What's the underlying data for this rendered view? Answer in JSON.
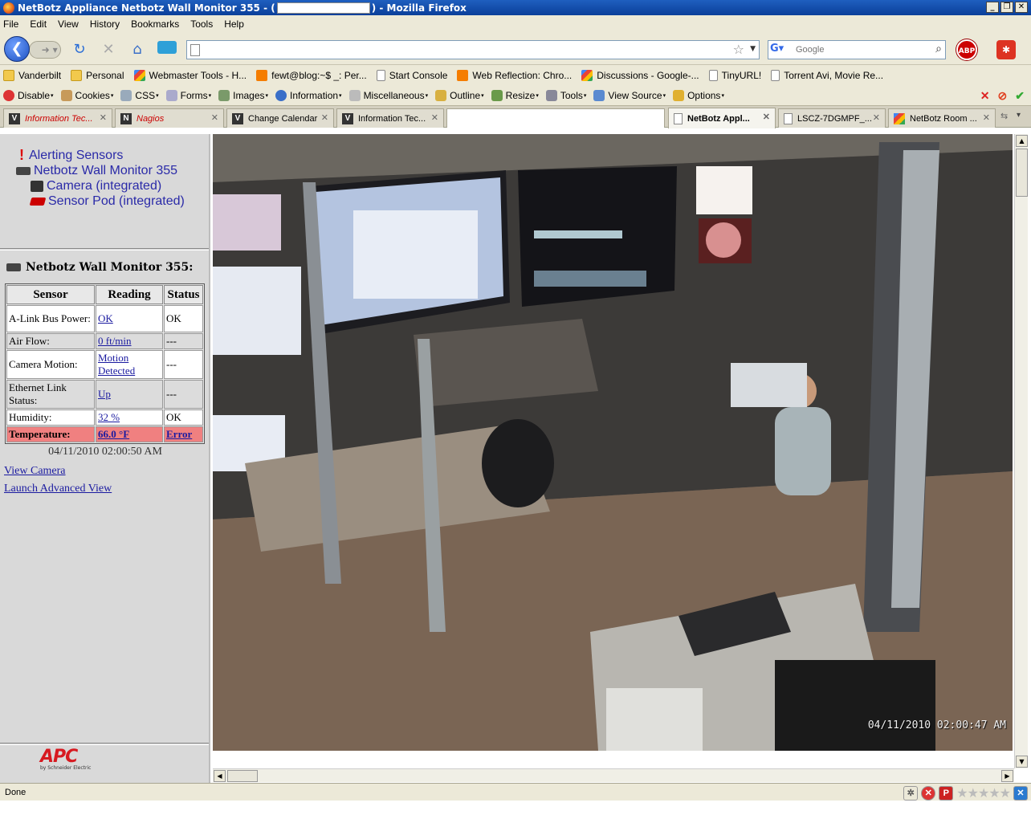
{
  "window": {
    "title_prefix": "NetBotz Appliance Netbotz Wall Monitor 355 - (",
    "title_suffix": ") - Mozilla Firefox",
    "minimize": "_",
    "restore": "❐",
    "close": "✕"
  },
  "menu": [
    "File",
    "Edit",
    "View",
    "History",
    "Bookmarks",
    "Tools",
    "Help"
  ],
  "search": {
    "placeholder": "Google"
  },
  "bookmarks": [
    {
      "label": "Vanderbilt",
      "icon": "folder"
    },
    {
      "label": "Personal",
      "icon": "folder"
    },
    {
      "label": "Webmaster Tools - H...",
      "icon": "google"
    },
    {
      "label": "fewt@blog:~$ _: Per...",
      "icon": "blogger"
    },
    {
      "label": "Start Console",
      "icon": "page"
    },
    {
      "label": "Web Reflection: Chro...",
      "icon": "blogger"
    },
    {
      "label": "Discussions - Google-...",
      "icon": "google"
    },
    {
      "label": "TinyURL!",
      "icon": "page"
    },
    {
      "label": "Torrent Avi, Movie Re...",
      "icon": "page"
    }
  ],
  "devtools": [
    {
      "label": "Disable",
      "icon": "disable-icon"
    },
    {
      "label": "Cookies",
      "icon": "cookies-icon"
    },
    {
      "label": "CSS",
      "icon": "css-icon"
    },
    {
      "label": "Forms",
      "icon": "forms-icon"
    },
    {
      "label": "Images",
      "icon": "images-icon"
    },
    {
      "label": "Information",
      "icon": "information-icon"
    },
    {
      "label": "Miscellaneous",
      "icon": "miscellaneous-icon"
    },
    {
      "label": "Outline",
      "icon": "outline-icon"
    },
    {
      "label": "Resize",
      "icon": "resize-icon"
    },
    {
      "label": "Tools",
      "icon": "tools-icon"
    },
    {
      "label": "View Source",
      "icon": "view-source-icon"
    },
    {
      "label": "Options",
      "icon": "options-icon"
    }
  ],
  "tabs": [
    {
      "label": "Information Tec...",
      "fav": "V",
      "style": "italic-red"
    },
    {
      "label": "Nagios",
      "fav": "N",
      "style": "italic-red"
    },
    {
      "label": "Change Calendar",
      "fav": "V",
      "style": ""
    },
    {
      "label": "Information Tec...",
      "fav": "V",
      "style": ""
    },
    {
      "label": "",
      "fav": "",
      "style": "empty"
    },
    {
      "label": "NetBotz Appl...",
      "fav": "",
      "style": "active"
    },
    {
      "label": "LSCZ-7DGMPF_...",
      "fav": "",
      "style": ""
    },
    {
      "label": "NetBotz Room ...",
      "fav": "G",
      "style": ""
    }
  ],
  "tree": {
    "alerting": "Alerting Sensors",
    "device": "Netbotz Wall Monitor 355",
    "camera": "Camera (integrated)",
    "pod": "Sensor Pod (integrated)"
  },
  "device_title": "Netbotz Wall Monitor 355:",
  "sensor_table": {
    "headers": [
      "Sensor",
      "Reading",
      "Status"
    ],
    "rows": [
      {
        "sensor": "A-Link Bus Power:",
        "reading": "OK",
        "status": "OK"
      },
      {
        "sensor": "Air Flow:",
        "reading": "0 ft/min",
        "status": "---"
      },
      {
        "sensor": "Camera Motion:",
        "reading": "Motion Detected",
        "status": "---"
      },
      {
        "sensor": "Ethernet Link Status:",
        "reading": "Up",
        "status": "---"
      },
      {
        "sensor": "Humidity:",
        "reading": "32 %",
        "status": "OK"
      },
      {
        "sensor": "Temperature:",
        "reading": "66.0 °F",
        "status": "Error"
      }
    ]
  },
  "timestamp": "04/11/2010 02:00:50 AM",
  "links": {
    "view_camera": "View Camera",
    "launch_advanced": "Launch Advanced View"
  },
  "logo": {
    "brand": "APC",
    "sub": "by Schneider Electric"
  },
  "camera_timestamp": "04/11/2010 02:00:47 AM",
  "status": "Done"
}
